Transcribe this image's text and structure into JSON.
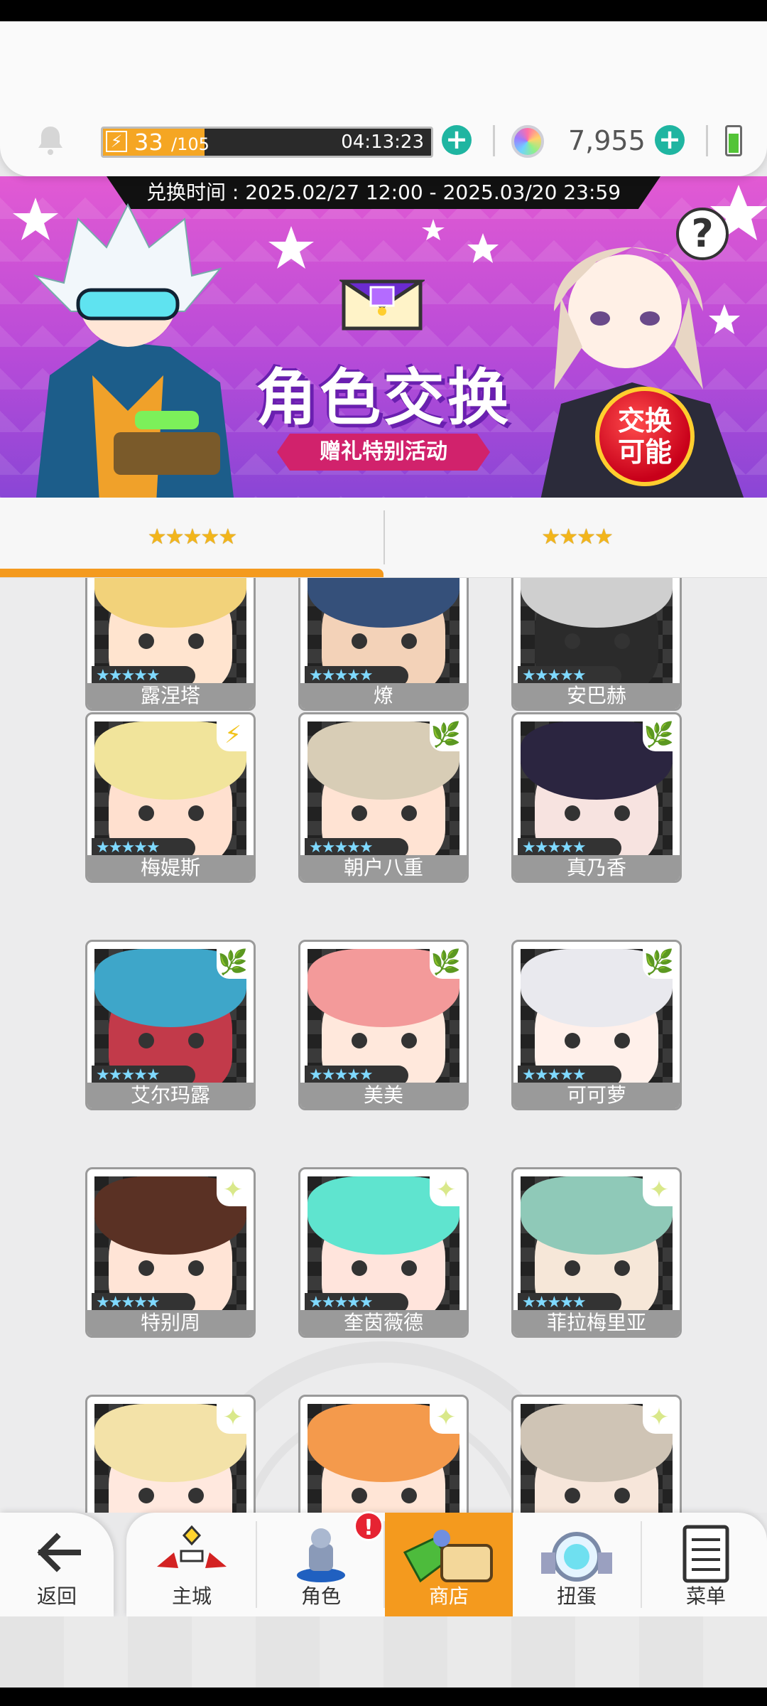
{
  "topbar": {
    "stamina_current": "33",
    "stamina_max": "/105",
    "stamina_fraction": 0.31,
    "stamina_timer": "04:13:23",
    "gem_count": "7,955"
  },
  "banner": {
    "exchange_period": "兑换时间 : 2025.02/27 12:00 - 2025.03/20 23:59",
    "title": "角色交换",
    "subtitle": "赠礼特别活动",
    "badge": "交换可能",
    "help": "?"
  },
  "tabs": [
    {
      "label": "★★★★★",
      "selected": true
    },
    {
      "label": "★★★★",
      "selected": false
    }
  ],
  "colors": {
    "accent": "#f49a1e",
    "teal": "#1fb5a1",
    "badge_red": "#e62332"
  },
  "characters": [
    {
      "name": "露涅塔",
      "stars": "★★★★★",
      "attr": "",
      "hair": "#f2d27a",
      "skin": "#ffe4cf"
    },
    {
      "name": "燎",
      "stars": "★★★★★",
      "attr": "",
      "hair": "#35507a",
      "skin": "#f3d2b8"
    },
    {
      "name": "安巴赫",
      "stars": "★★★★★",
      "attr": "",
      "hair": "#cfcfcf",
      "skin": "#2b2b2b"
    },
    {
      "name": "梅媞斯",
      "stars": "★★★★★",
      "attr": "⚡",
      "hair": "#f1e49b",
      "skin": "#ffe0cf"
    },
    {
      "name": "朝户八重",
      "stars": "★★★★★",
      "attr": "🌿",
      "hair": "#d8cdb6",
      "skin": "#ffe3d3"
    },
    {
      "name": "真乃香",
      "stars": "★★★★★",
      "attr": "🌿",
      "hair": "#2b2540",
      "skin": "#f7e3e0"
    },
    {
      "name": "艾尔玛露",
      "stars": "★★★★★",
      "attr": "🌿",
      "hair": "#3ea6c9",
      "skin": "#c23a4a"
    },
    {
      "name": "美美",
      "stars": "★★★★★",
      "attr": "🌿",
      "hair": "#f39a9a",
      "skin": "#ffe8dc"
    },
    {
      "name": "可可萝",
      "stars": "★★★★★",
      "attr": "🌿",
      "hair": "#e9e9ee",
      "skin": "#fff0ea"
    },
    {
      "name": "特别周",
      "stars": "★★★★★",
      "attr": "✦",
      "hair": "#5a3124",
      "skin": "#ffe4d6"
    },
    {
      "name": "奎茵薇德",
      "stars": "★★★★★",
      "attr": "✦",
      "hair": "#5fe4cf",
      "skin": "#ffe4dc"
    },
    {
      "name": "菲拉梅里亚",
      "stars": "★★★★★",
      "attr": "✦",
      "hair": "#8fc9b8",
      "skin": "#f6e7d8"
    },
    {
      "name": "",
      "stars": "",
      "attr": "✦",
      "hair": "#f3e2a8",
      "skin": "#ffe8de"
    },
    {
      "name": "",
      "stars": "",
      "attr": "✦",
      "hair": "#f49a4c",
      "skin": "#ffe5d6"
    },
    {
      "name": "",
      "stars": "",
      "attr": "✦",
      "hair": "#cfc4b5",
      "skin": "#f7e6da"
    }
  ],
  "nav": {
    "back": "返回",
    "main_city": "主城",
    "character": "角色",
    "shop": "商店",
    "gacha": "扭蛋",
    "menu": "菜单",
    "character_notification": "!"
  }
}
